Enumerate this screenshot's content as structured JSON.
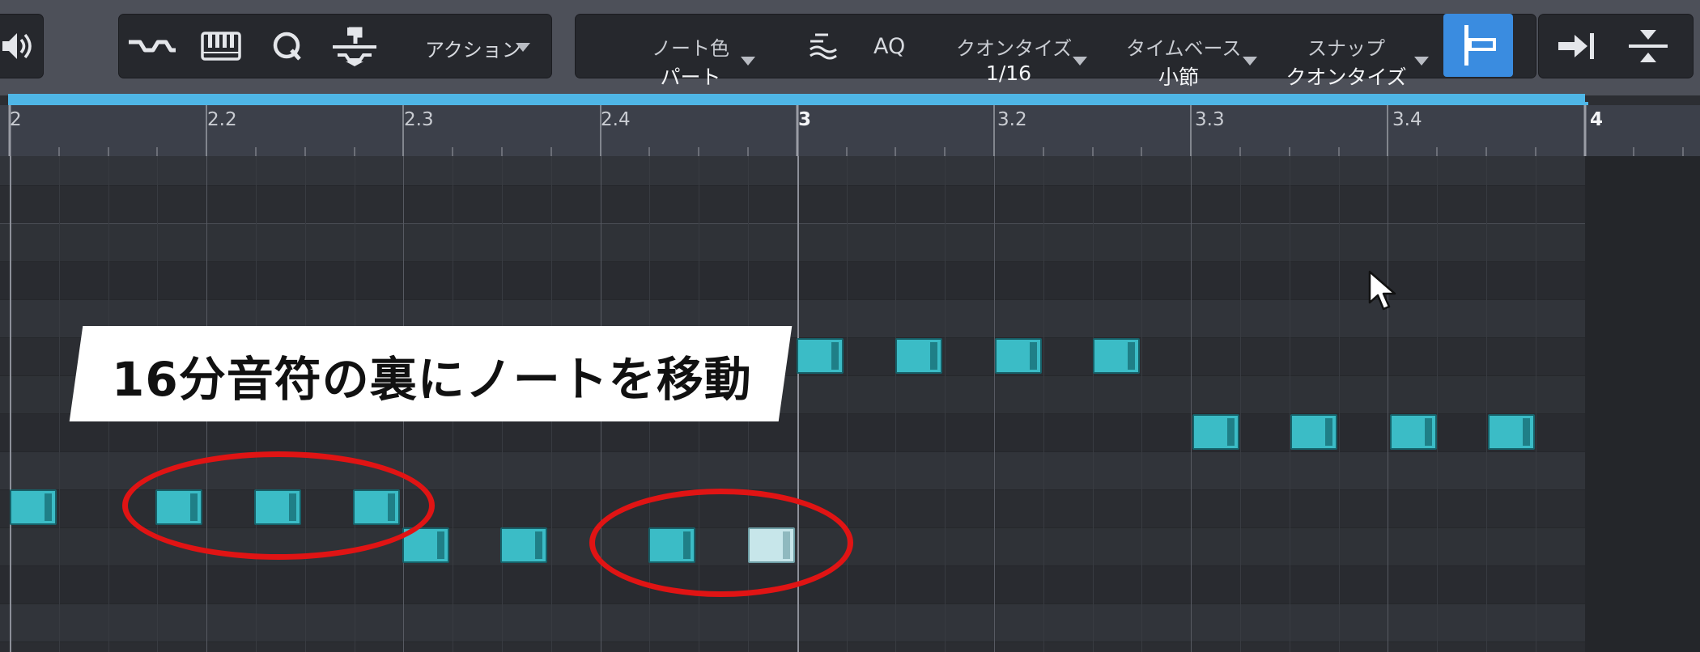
{
  "toolbar": {
    "action_label": "アクション",
    "note_color": {
      "label": "ノート色",
      "value": "パート"
    },
    "aq_label": "AQ",
    "quantize": {
      "label": "クオンタイズ",
      "value": "1/16"
    },
    "timebase": {
      "label": "タイムベース",
      "value": "小節"
    },
    "snap": {
      "label": "スナップ",
      "value": "クオンタイズ"
    }
  },
  "ruler": {
    "labels": [
      "2",
      "2.2",
      "2.3",
      "2.4",
      "3",
      "3.2",
      "3.3",
      "3.4",
      "4"
    ]
  },
  "caption": "16分音符の裏にノートを移動",
  "colors": {
    "accent": "#3a8ce0",
    "note_fill": "#3bbcc6",
    "note_selected": "#c7e6ea",
    "highlight_ring": "#e01414"
  }
}
